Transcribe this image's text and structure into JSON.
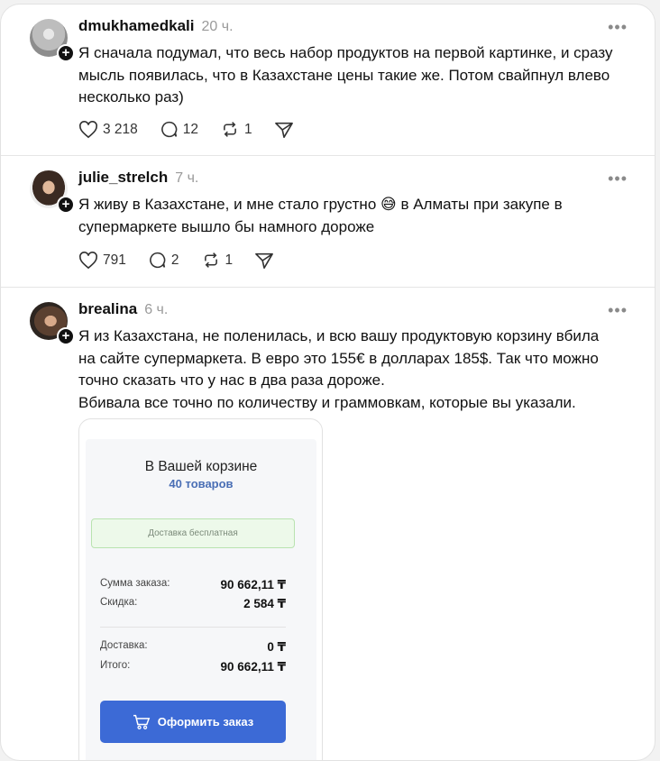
{
  "posts": [
    {
      "username": "dmukhamedkali",
      "time": "20 ч.",
      "text": "Я сначала подумал, что весь набор продуктов на первой картинке, и сразу\nмысль появилась, что в Казахстане цены такие же. Потом свайпнул влево\nнесколько раз)",
      "likes": "3 218",
      "comments": "12",
      "reposts": "1"
    },
    {
      "username": "julie_strelch",
      "time": "7 ч.",
      "text": "Я живу в Казахстане, и мне стало грустно 😅 в Алматы при закупе в\nсупермаркете вышло бы намного дороже",
      "likes": "791",
      "comments": "2",
      "reposts": "1"
    },
    {
      "username": "brealina",
      "time": "6 ч.",
      "text": "Я из Казахстана, не поленилась, и всю вашу продуктовую корзину вбила\nна сайте супермаркета. В евро это 155€ в долларах 185$. Так что можно\nточно сказать что у нас в два раза дороже.\nВбивала все точно по количеству и граммовкам, которые вы указали.",
      "attachment": {
        "title": "В Вашей корзине",
        "count": "40 товаров",
        "delivery_note": "Доставка бесплатная",
        "sum_label": "Сумма заказа:",
        "sum_value": "90 662,11 ₸",
        "discount_label": "Скидка:",
        "discount_value": "2 584 ₸",
        "delivery_label": "Доставка:",
        "delivery_value": "0 ₸",
        "total_label": "Итого:",
        "total_value": "90 662,11 ₸",
        "button": "Оформить заказ"
      }
    }
  ],
  "icons": {
    "more": "more-icon",
    "like": "heart-icon",
    "comment": "comment-icon",
    "repost": "repost-icon",
    "share": "send-icon",
    "follow": "plus-icon",
    "cart": "cart-icon"
  },
  "colors": {
    "accent_button": "#3c6ad6",
    "count_text": "#4a6fb5",
    "delivery_bg": "#edf9ea"
  }
}
